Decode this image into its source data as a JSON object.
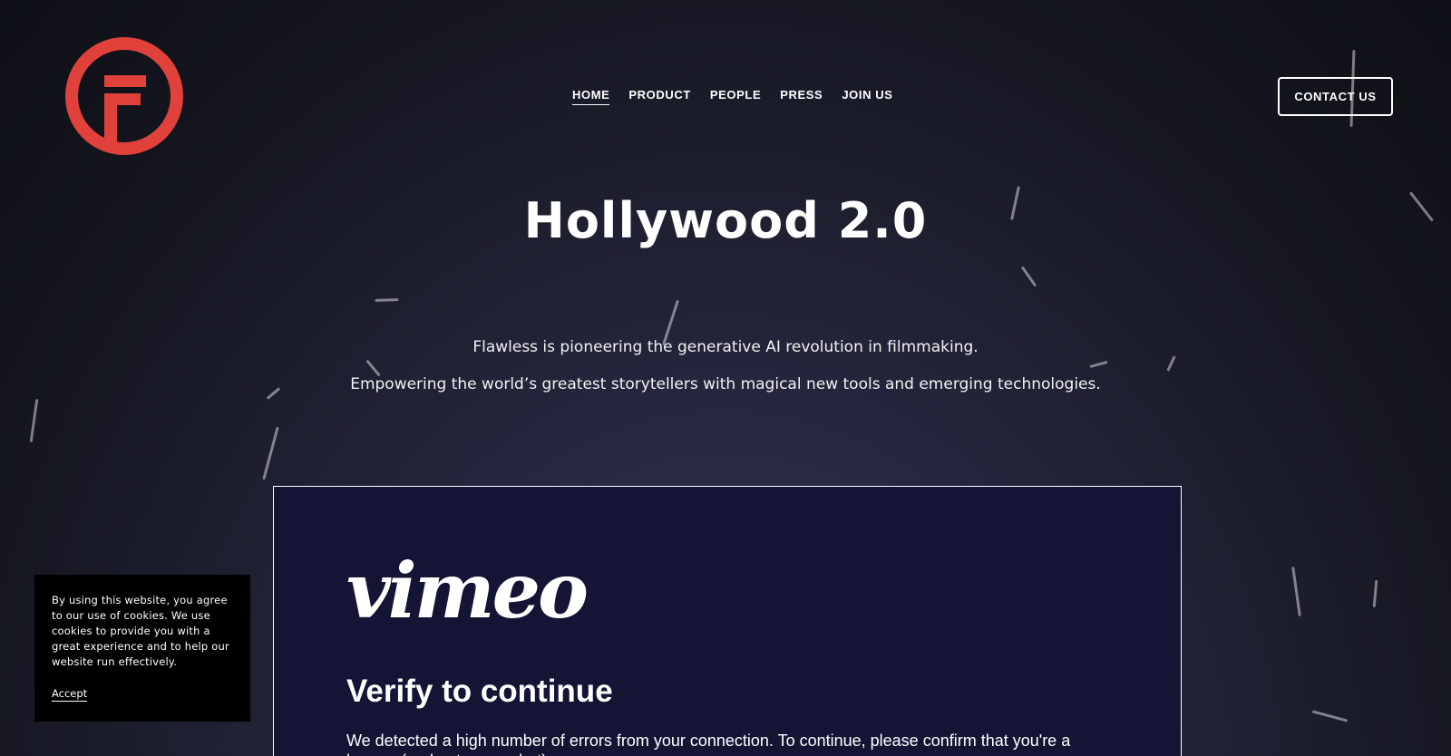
{
  "brand": {
    "logo_icon": "flawless-f-logo-icon",
    "logo_color": "#e0413b"
  },
  "nav": {
    "items": [
      {
        "label": "HOME",
        "active": true
      },
      {
        "label": "PRODUCT",
        "active": false
      },
      {
        "label": "PEOPLE",
        "active": false
      },
      {
        "label": "PRESS",
        "active": false
      },
      {
        "label": "JOIN US",
        "active": false
      }
    ],
    "contact_label": "CONTACT US"
  },
  "hero": {
    "title": "Hollywood 2.0",
    "line1": "Flawless is pioneering the generative AI revolution in filmmaking.",
    "line2": "Empowering the world’s greatest storytellers with magical new tools and emerging technologies."
  },
  "embed": {
    "logo_text": "vimeo",
    "title": "Verify to continue",
    "message": "We detected a high number of errors from your connection. To continue, please confirm that you're a human (and not a spambot)."
  },
  "cookie": {
    "text": "By using this website, you agree to our use of cookies. We use cookies to provide you with a great experience and to help our website run effectively.",
    "accept_label": "Accept"
  }
}
